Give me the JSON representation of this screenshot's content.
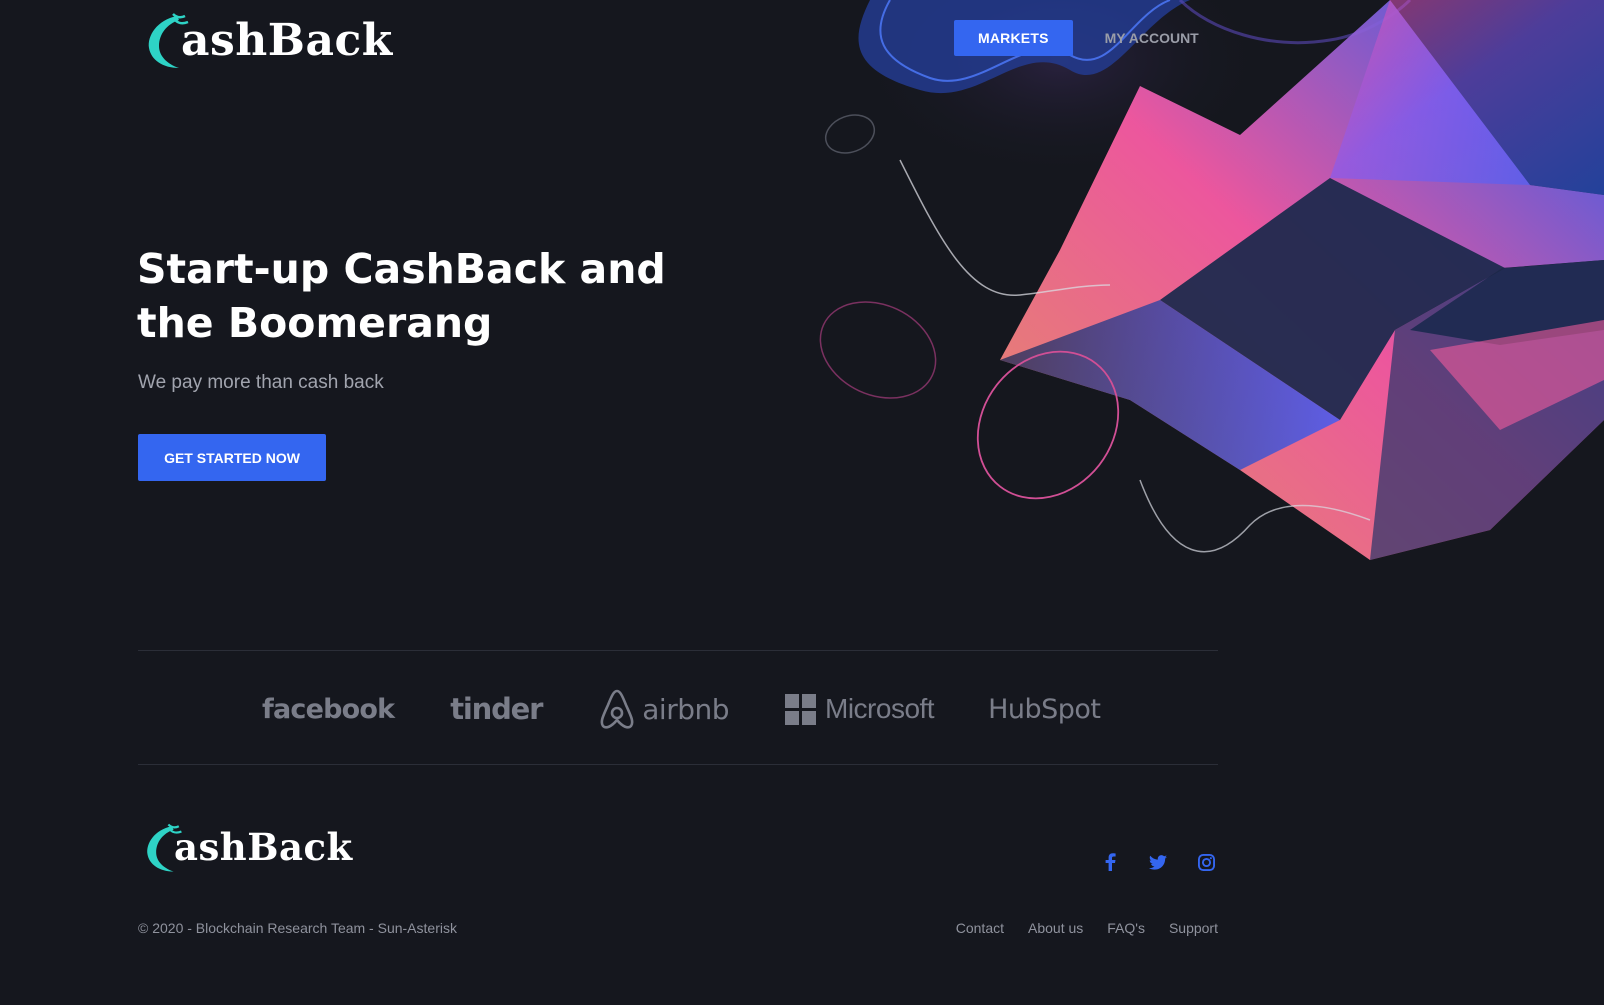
{
  "brand": {
    "name": "ashBack",
    "accent": "#2ed3c6"
  },
  "nav": {
    "markets_label": "MARKETS",
    "account_label": "MY ACCOUNT"
  },
  "hero": {
    "title_line1": "Start-up CashBack and",
    "title_line2": "the Boomerang",
    "subtitle": "We pay more than cash back",
    "cta_label": "GET STARTED NOW"
  },
  "partners": {
    "facebook": "facebook",
    "tinder": "tinder",
    "airbnb": "airbnb",
    "microsoft": "Microsoft",
    "hubspot": "HubSpot"
  },
  "footer": {
    "social_icons": [
      "facebook-icon",
      "twitter-icon",
      "instagram-icon"
    ],
    "copyright": "© 2020 - Blockchain Research Team - Sun-Asterisk",
    "links": [
      "Contact",
      "About us",
      "FAQ's",
      "Support"
    ]
  },
  "colors": {
    "background": "#15171e",
    "primary": "#3466f0",
    "muted_text": "#8f929d",
    "logo_gray": "#7a7d89"
  }
}
